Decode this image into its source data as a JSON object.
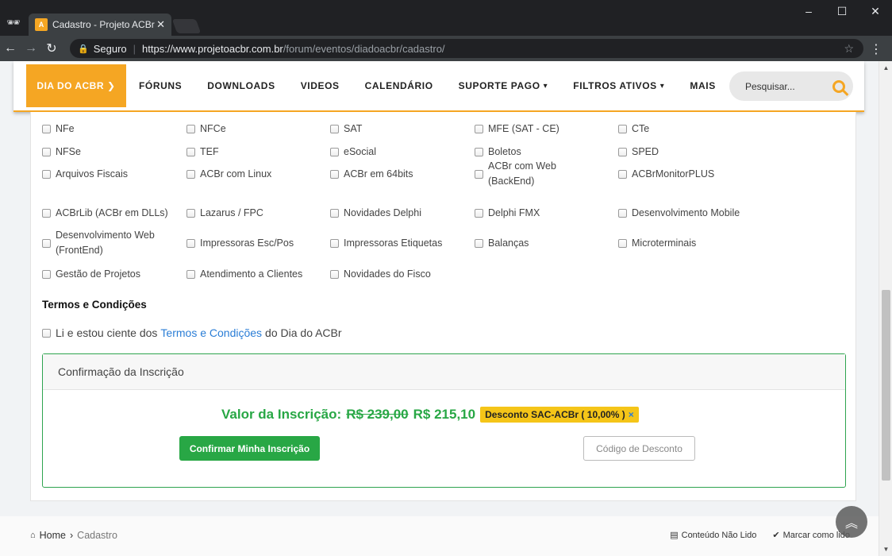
{
  "browser": {
    "tab_title": "Cadastro - Projeto ACBr",
    "secure_label": "Seguro",
    "url_host": "https://www.projetoacbr.com.br",
    "url_path": "/forum/eventos/diadoacbr/cadastro/"
  },
  "nav": {
    "brand": "DIA DO ACBR",
    "items": [
      "FÓRUNS",
      "DOWNLOADS",
      "VIDEOS",
      "CALENDÁRIO",
      "SUPORTE PAGO",
      "FILTROS ATIVOS",
      "MAIS"
    ],
    "search_placeholder": "Pesquisar..."
  },
  "interests": [
    "NFe",
    "NFCe",
    "SAT",
    "MFE (SAT - CE)",
    "CTe",
    "NFSe",
    "TEF",
    "eSocial",
    "Boletos",
    "SPED",
    "Arquivos Fiscais",
    "ACBr com Linux",
    "ACBr em 64bits",
    "ACBr com Web (BackEnd)",
    "ACBrMonitorPLUS",
    "ACBrLib (ACBr em DLLs)",
    "Lazarus / FPC",
    "Novidades Delphi",
    "Delphi FMX",
    "Desenvolvimento Mobile",
    "Desenvolvimento Web (FrontEnd)",
    "Impressoras Esc/Pos",
    "Impressoras Etiquetas",
    "Balanças",
    "Microterminais",
    "Gestão de Projetos",
    "Atendimento a Clientes",
    "Novidades do Fisco"
  ],
  "terms": {
    "title": "Termos e Condições",
    "prefix": "Li e estou ciente dos",
    "link": "Termos e Condições",
    "suffix": "do Dia do ACBr"
  },
  "confirmation": {
    "header": "Confirmação da Inscrição",
    "price_label": "Valor da Inscrição:",
    "old_price": "R$ 239,00",
    "new_price": "R$ 215,10",
    "discount_badge": "Desconto SAC-ACBr ( 10,00% )",
    "confirm_button": "Confirmar Minha Inscrição",
    "code_button": "Código de Desconto"
  },
  "footer": {
    "home": "Home",
    "current": "Cadastro",
    "unread": "Conteúdo Não Lido",
    "mark_read": "Marcar como lido"
  },
  "colors": {
    "brand": "#f5a623",
    "success": "#28a745",
    "link": "#2a7dd6",
    "badge": "#f5c518"
  }
}
